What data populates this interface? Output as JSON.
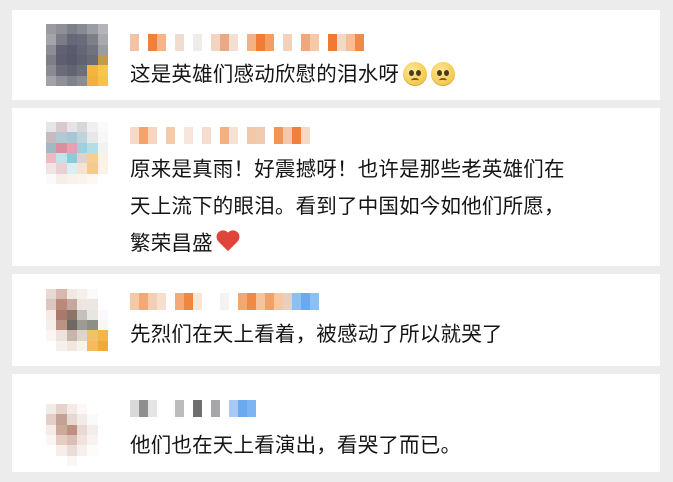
{
  "comments": [
    {
      "text": "这是英雄们感动欣慰的泪水呀",
      "emoji": "pleading-face-icon"
    },
    {
      "lines": [
        "原来是真雨！好震撼呀！也许是那些老英雄们在",
        "天上流下的眼泪。看到了中国如今如他们所愿，",
        "繁荣昌盛"
      ],
      "emoji": "heart-icon"
    },
    {
      "text": "先烈们在天上看着，被感动了所以就哭了"
    },
    {
      "text": "他们也在天上看演出，看哭了而已。"
    }
  ],
  "colors": {
    "background": "#ececed",
    "card": "#ffffff",
    "text": "#151515",
    "mosaic_orange": "#f08a3c",
    "mosaic_blue": "#6aa8f0"
  }
}
